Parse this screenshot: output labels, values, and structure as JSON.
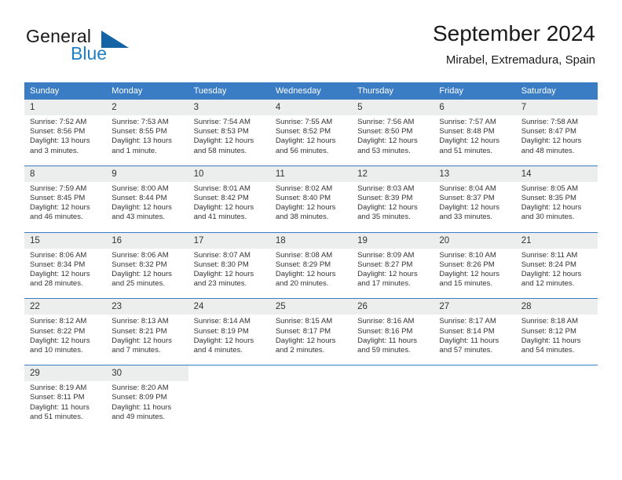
{
  "brand": {
    "name_part1": "General",
    "name_part2": "Blue",
    "logo_icon": "triangle-flag-icon"
  },
  "header": {
    "title": "September 2024",
    "subtitle": "Mirabel, Extremadura, Spain"
  },
  "colors": {
    "header_blue": "#3b7dc4",
    "brand_blue": "#1e7fc4",
    "daynum_bg": "#eceded",
    "text": "#333333"
  },
  "weekday_headers": [
    "Sunday",
    "Monday",
    "Tuesday",
    "Wednesday",
    "Thursday",
    "Friday",
    "Saturday"
  ],
  "weeks": [
    {
      "days": [
        {
          "num": "1",
          "sunrise": "Sunrise: 7:52 AM",
          "sunset": "Sunset: 8:56 PM",
          "daylight_line1": "Daylight: 13 hours",
          "daylight_line2": "and 3 minutes."
        },
        {
          "num": "2",
          "sunrise": "Sunrise: 7:53 AM",
          "sunset": "Sunset: 8:55 PM",
          "daylight_line1": "Daylight: 13 hours",
          "daylight_line2": "and 1 minute."
        },
        {
          "num": "3",
          "sunrise": "Sunrise: 7:54 AM",
          "sunset": "Sunset: 8:53 PM",
          "daylight_line1": "Daylight: 12 hours",
          "daylight_line2": "and 58 minutes."
        },
        {
          "num": "4",
          "sunrise": "Sunrise: 7:55 AM",
          "sunset": "Sunset: 8:52 PM",
          "daylight_line1": "Daylight: 12 hours",
          "daylight_line2": "and 56 minutes."
        },
        {
          "num": "5",
          "sunrise": "Sunrise: 7:56 AM",
          "sunset": "Sunset: 8:50 PM",
          "daylight_line1": "Daylight: 12 hours",
          "daylight_line2": "and 53 minutes."
        },
        {
          "num": "6",
          "sunrise": "Sunrise: 7:57 AM",
          "sunset": "Sunset: 8:48 PM",
          "daylight_line1": "Daylight: 12 hours",
          "daylight_line2": "and 51 minutes."
        },
        {
          "num": "7",
          "sunrise": "Sunrise: 7:58 AM",
          "sunset": "Sunset: 8:47 PM",
          "daylight_line1": "Daylight: 12 hours",
          "daylight_line2": "and 48 minutes."
        }
      ]
    },
    {
      "days": [
        {
          "num": "8",
          "sunrise": "Sunrise: 7:59 AM",
          "sunset": "Sunset: 8:45 PM",
          "daylight_line1": "Daylight: 12 hours",
          "daylight_line2": "and 46 minutes."
        },
        {
          "num": "9",
          "sunrise": "Sunrise: 8:00 AM",
          "sunset": "Sunset: 8:44 PM",
          "daylight_line1": "Daylight: 12 hours",
          "daylight_line2": "and 43 minutes."
        },
        {
          "num": "10",
          "sunrise": "Sunrise: 8:01 AM",
          "sunset": "Sunset: 8:42 PM",
          "daylight_line1": "Daylight: 12 hours",
          "daylight_line2": "and 41 minutes."
        },
        {
          "num": "11",
          "sunrise": "Sunrise: 8:02 AM",
          "sunset": "Sunset: 8:40 PM",
          "daylight_line1": "Daylight: 12 hours",
          "daylight_line2": "and 38 minutes."
        },
        {
          "num": "12",
          "sunrise": "Sunrise: 8:03 AM",
          "sunset": "Sunset: 8:39 PM",
          "daylight_line1": "Daylight: 12 hours",
          "daylight_line2": "and 35 minutes."
        },
        {
          "num": "13",
          "sunrise": "Sunrise: 8:04 AM",
          "sunset": "Sunset: 8:37 PM",
          "daylight_line1": "Daylight: 12 hours",
          "daylight_line2": "and 33 minutes."
        },
        {
          "num": "14",
          "sunrise": "Sunrise: 8:05 AM",
          "sunset": "Sunset: 8:35 PM",
          "daylight_line1": "Daylight: 12 hours",
          "daylight_line2": "and 30 minutes."
        }
      ]
    },
    {
      "days": [
        {
          "num": "15",
          "sunrise": "Sunrise: 8:06 AM",
          "sunset": "Sunset: 8:34 PM",
          "daylight_line1": "Daylight: 12 hours",
          "daylight_line2": "and 28 minutes."
        },
        {
          "num": "16",
          "sunrise": "Sunrise: 8:06 AM",
          "sunset": "Sunset: 8:32 PM",
          "daylight_line1": "Daylight: 12 hours",
          "daylight_line2": "and 25 minutes."
        },
        {
          "num": "17",
          "sunrise": "Sunrise: 8:07 AM",
          "sunset": "Sunset: 8:30 PM",
          "daylight_line1": "Daylight: 12 hours",
          "daylight_line2": "and 23 minutes."
        },
        {
          "num": "18",
          "sunrise": "Sunrise: 8:08 AM",
          "sunset": "Sunset: 8:29 PM",
          "daylight_line1": "Daylight: 12 hours",
          "daylight_line2": "and 20 minutes."
        },
        {
          "num": "19",
          "sunrise": "Sunrise: 8:09 AM",
          "sunset": "Sunset: 8:27 PM",
          "daylight_line1": "Daylight: 12 hours",
          "daylight_line2": "and 17 minutes."
        },
        {
          "num": "20",
          "sunrise": "Sunrise: 8:10 AM",
          "sunset": "Sunset: 8:26 PM",
          "daylight_line1": "Daylight: 12 hours",
          "daylight_line2": "and 15 minutes."
        },
        {
          "num": "21",
          "sunrise": "Sunrise: 8:11 AM",
          "sunset": "Sunset: 8:24 PM",
          "daylight_line1": "Daylight: 12 hours",
          "daylight_line2": "and 12 minutes."
        }
      ]
    },
    {
      "days": [
        {
          "num": "22",
          "sunrise": "Sunrise: 8:12 AM",
          "sunset": "Sunset: 8:22 PM",
          "daylight_line1": "Daylight: 12 hours",
          "daylight_line2": "and 10 minutes."
        },
        {
          "num": "23",
          "sunrise": "Sunrise: 8:13 AM",
          "sunset": "Sunset: 8:21 PM",
          "daylight_line1": "Daylight: 12 hours",
          "daylight_line2": "and 7 minutes."
        },
        {
          "num": "24",
          "sunrise": "Sunrise: 8:14 AM",
          "sunset": "Sunset: 8:19 PM",
          "daylight_line1": "Daylight: 12 hours",
          "daylight_line2": "and 4 minutes."
        },
        {
          "num": "25",
          "sunrise": "Sunrise: 8:15 AM",
          "sunset": "Sunset: 8:17 PM",
          "daylight_line1": "Daylight: 12 hours",
          "daylight_line2": "and 2 minutes."
        },
        {
          "num": "26",
          "sunrise": "Sunrise: 8:16 AM",
          "sunset": "Sunset: 8:16 PM",
          "daylight_line1": "Daylight: 11 hours",
          "daylight_line2": "and 59 minutes."
        },
        {
          "num": "27",
          "sunrise": "Sunrise: 8:17 AM",
          "sunset": "Sunset: 8:14 PM",
          "daylight_line1": "Daylight: 11 hours",
          "daylight_line2": "and 57 minutes."
        },
        {
          "num": "28",
          "sunrise": "Sunrise: 8:18 AM",
          "sunset": "Sunset: 8:12 PM",
          "daylight_line1": "Daylight: 11 hours",
          "daylight_line2": "and 54 minutes."
        }
      ]
    },
    {
      "days": [
        {
          "num": "29",
          "sunrise": "Sunrise: 8:19 AM",
          "sunset": "Sunset: 8:11 PM",
          "daylight_line1": "Daylight: 11 hours",
          "daylight_line2": "and 51 minutes."
        },
        {
          "num": "30",
          "sunrise": "Sunrise: 8:20 AM",
          "sunset": "Sunset: 8:09 PM",
          "daylight_line1": "Daylight: 11 hours",
          "daylight_line2": "and 49 minutes."
        },
        {
          "num": "",
          "sunrise": "",
          "sunset": "",
          "daylight_line1": "",
          "daylight_line2": ""
        },
        {
          "num": "",
          "sunrise": "",
          "sunset": "",
          "daylight_line1": "",
          "daylight_line2": ""
        },
        {
          "num": "",
          "sunrise": "",
          "sunset": "",
          "daylight_line1": "",
          "daylight_line2": ""
        },
        {
          "num": "",
          "sunrise": "",
          "sunset": "",
          "daylight_line1": "",
          "daylight_line2": ""
        },
        {
          "num": "",
          "sunrise": "",
          "sunset": "",
          "daylight_line1": "",
          "daylight_line2": ""
        }
      ]
    }
  ]
}
